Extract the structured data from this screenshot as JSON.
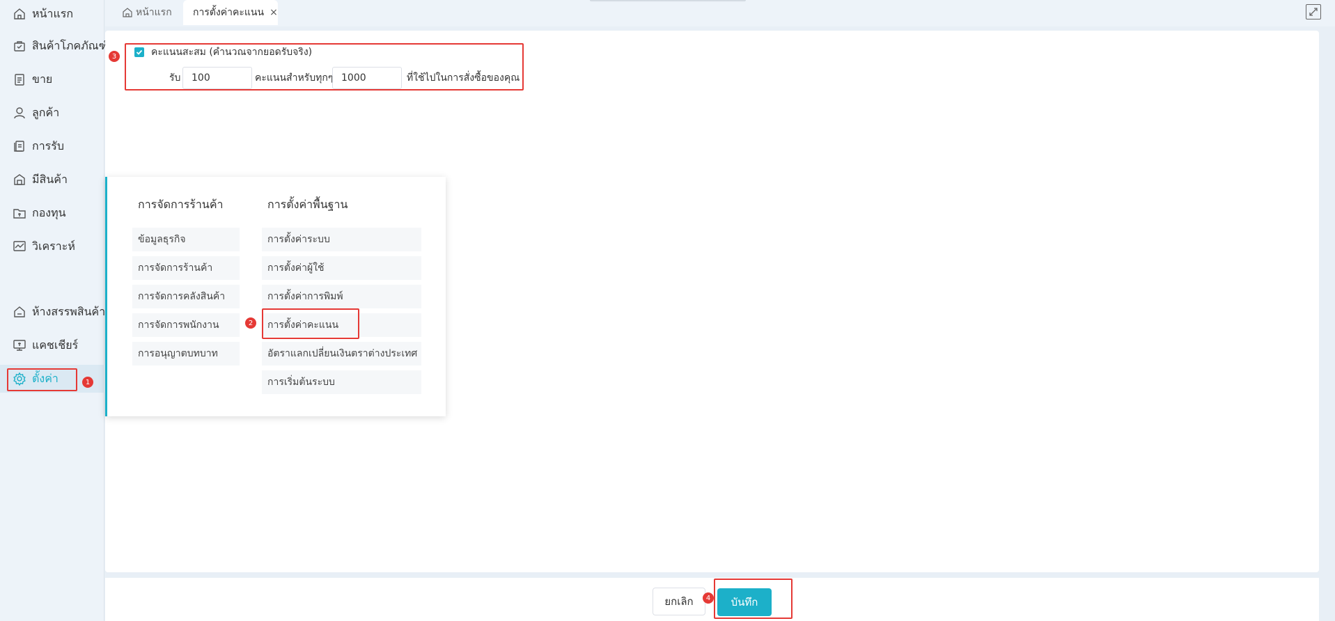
{
  "sidebar": {
    "items": [
      {
        "label": "หน้าแรก",
        "icon": "home-icon"
      },
      {
        "label": "สินค้าโภคภัณฑ์",
        "icon": "bag-icon"
      },
      {
        "label": "ขาย",
        "icon": "clipboard-icon"
      },
      {
        "label": "ลูกค้า",
        "icon": "user-icon"
      },
      {
        "label": "การรับ",
        "icon": "receipt-icon"
      },
      {
        "label": "มีสินค้า",
        "icon": "warehouse-icon"
      },
      {
        "label": "กองทุน",
        "icon": "folder-money-icon"
      },
      {
        "label": "วิเคราะห์",
        "icon": "chart-icon"
      },
      {
        "label": "ห้างสรรพสินค้า",
        "icon": "store-icon"
      },
      {
        "label": "แคชเชียร์",
        "icon": "monitor-icon"
      },
      {
        "label": "ตั้งค่า",
        "icon": "gear-icon",
        "active": true
      }
    ]
  },
  "tabs": {
    "home": "หน้าแรก",
    "current": "การตั้งค่าคะแนน",
    "close": "×"
  },
  "points": {
    "checkbox_label": "คะแนนสะสม (คำนวณจากยอดรับจริง)",
    "checked": true,
    "receive_label": "รับ",
    "points_value": "100",
    "per_label": "คะแนนสำหรับทุกๆ",
    "amount_value": "1000",
    "suffix_label": "ที่ใช้ไปในการสั่งซื้อของคุณ"
  },
  "settings_menu": {
    "store_management": {
      "heading": "การจัดการร้านค้า",
      "items": [
        "ข้อมูลธุรกิจ",
        "การจัดการร้านค้า",
        "การจัดการคลังสินค้า",
        "การจัดการพนักงาน",
        "การอนุญาตบทบาท"
      ]
    },
    "basic_settings": {
      "heading": "การตั้งค่าพื้นฐาน",
      "items": [
        "การตั้งค่าระบบ",
        "การตั้งค่าผู้ใช้",
        "การตั้งค่าการพิมพ์",
        "การตั้งค่าคะแนน",
        "อัตราแลกเปลี่ยนเงินตราต่างประเทศ",
        "การเริ่มต้นระบบ"
      ]
    }
  },
  "footer": {
    "cancel_label": "ยกเลิก",
    "save_label": "บันทึก"
  },
  "badges": [
    "1",
    "2",
    "3",
    "4"
  ],
  "colors": {
    "accent": "#1cb0c9",
    "highlight": "#e53935"
  }
}
